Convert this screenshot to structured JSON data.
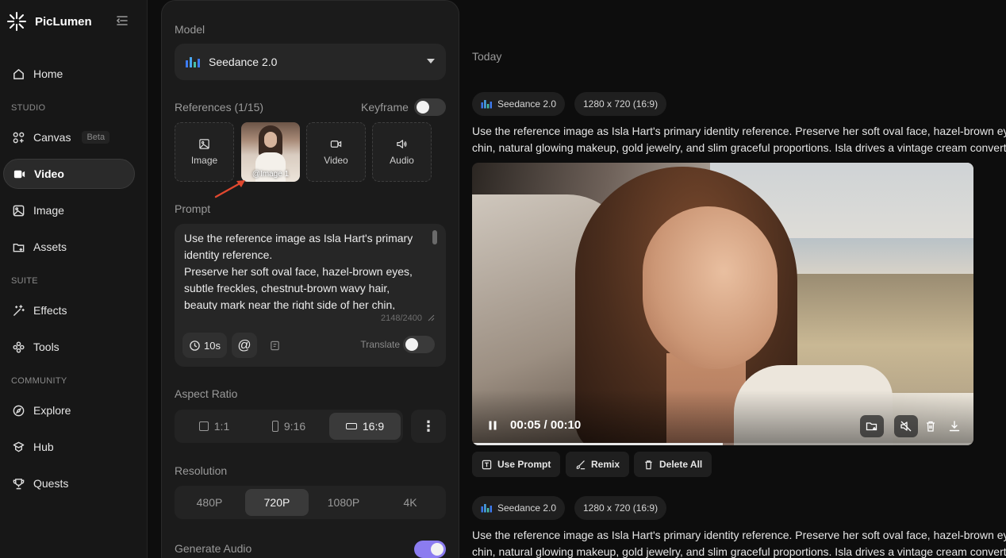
{
  "app": {
    "name": "PicLumen",
    "accent": "#8b7cf0"
  },
  "sidebar": {
    "items": [
      {
        "label": "Home",
        "icon": "home-icon"
      },
      {
        "section": "STUDIO"
      },
      {
        "label": "Canvas",
        "badge": "Beta",
        "icon": "canvas-icon"
      },
      {
        "label": "Video",
        "icon": "video-icon",
        "active": true
      },
      {
        "label": "Image",
        "icon": "image-icon"
      },
      {
        "label": "Assets",
        "icon": "assets-icon"
      },
      {
        "section": "SUITE"
      },
      {
        "label": "Effects",
        "icon": "effects-icon"
      },
      {
        "label": "Tools",
        "icon": "tools-icon"
      },
      {
        "section": "COMMUNITY"
      },
      {
        "label": "Explore",
        "icon": "compass-icon"
      },
      {
        "label": "Hub",
        "icon": "hub-icon"
      },
      {
        "label": "Quests",
        "icon": "trophy-icon"
      }
    ]
  },
  "panel": {
    "model_label": "Model",
    "model_value": "Seedance 2.0",
    "references_label": "References (1/15)",
    "keyframe_label": "Keyframe",
    "keyframe_on": false,
    "ref_tiles": {
      "image": "Image",
      "thumb_tag": "@Image 1",
      "video": "Video",
      "audio": "Audio"
    },
    "prompt_label": "Prompt",
    "prompt_text": "Use the reference image as Isla Hart's primary identity reference.\nPreserve her soft oval face, hazel-brown eyes, subtle freckles, chestnut-brown wavy hair, beauty mark near the right side of her chin,",
    "prompt_counter": "2148/2400",
    "duration": "10s",
    "mention": "@",
    "translate_label": "Translate",
    "translate_on": false,
    "aspect_label": "Aspect Ratio",
    "aspect_options": [
      "1:1",
      "9:16",
      "16:9"
    ],
    "aspect_selected": "16:9",
    "resolution_label": "Resolution",
    "resolution_options": [
      "480P",
      "720P",
      "1080P",
      "4K"
    ],
    "resolution_selected": "720P",
    "audio_label": "Generate Audio",
    "audio_on": true
  },
  "main": {
    "group_label": "Today",
    "card1": {
      "model": "Seedance 2.0",
      "size": "1280 x 720 (16:9)",
      "line1": "Use the reference image as Isla Hart's primary identity reference. Preserve her soft oval face, hazel-brown eyes",
      "line2": "chin, natural glowing makeup, gold jewelry, and slim graceful proportions. Isla drives a vintage cream convertible",
      "time": "00:05 / 00:10",
      "progress": 0.5,
      "actions": [
        "Use Prompt",
        "Remix",
        "Delete All"
      ]
    },
    "card2": {
      "model": "Seedance 2.0",
      "size": "1280 x 720 (16:9)",
      "line1": "Use the reference image as Isla Hart's primary identity reference. Preserve her soft oval face, hazel-brown eyes",
      "line2": "chin, natural glowing makeup, gold jewelry, and slim graceful proportions. Isla drives a vintage cream convertible"
    }
  }
}
